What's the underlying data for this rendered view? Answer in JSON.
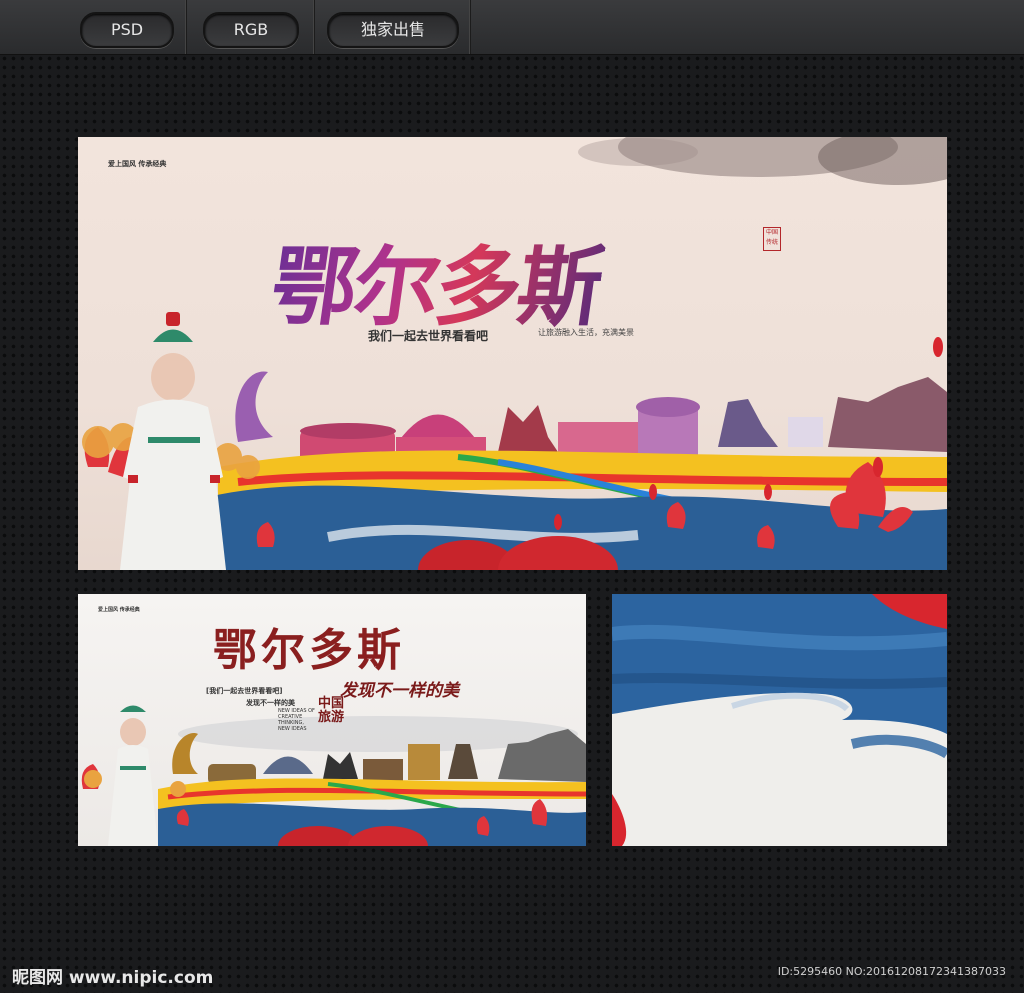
{
  "tabs": [
    {
      "label": "PSD"
    },
    {
      "label": "RGB"
    },
    {
      "label": "独家出售"
    }
  ],
  "poster_main": {
    "title": "鄂尔多斯",
    "slogan": "我们一起去世界看看吧",
    "slogan_right": "让旅游融入生活，充满美景",
    "top_left_text": "爱上国风 传承经典",
    "seal_text": "中国传统"
  },
  "poster_small": {
    "title": "鄂尔多斯",
    "slogan": "发现不一样的美",
    "bracket_text": "[我们一起去世界看看吧]",
    "sub_text": "发现不一样的美",
    "english": "NEW IDEAS OF CREATIVE THINKING, NEW IDEAS",
    "china_tour": "中国旅游",
    "top_left_text": "爱上国风 传承经典"
  },
  "footer": {
    "logo": "昵图网 www.nipic.com",
    "id_text": "ID:5295460 NO:20161208172341387033"
  },
  "colors": {
    "accent_red": "#c8242b",
    "title_purple": "#6a2f95",
    "sea_blue": "#2b5f96"
  }
}
